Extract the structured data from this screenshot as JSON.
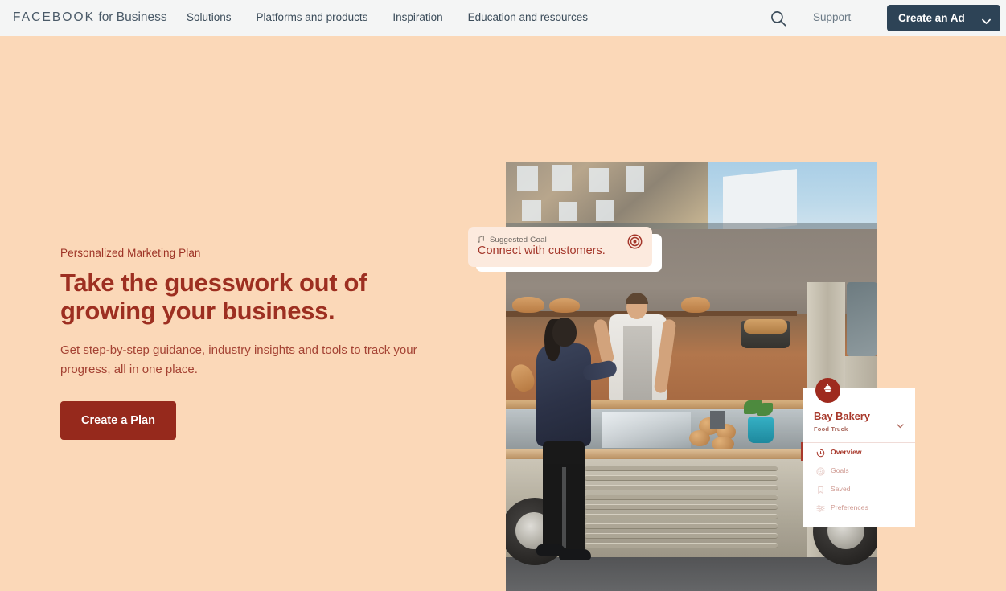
{
  "header": {
    "logo_brand": "FACEBOOK",
    "logo_suffix": " for Business",
    "nav": [
      {
        "label": "Solutions"
      },
      {
        "label": "Platforms and products"
      },
      {
        "label": "Inspiration"
      },
      {
        "label": "Education and resources"
      }
    ],
    "search_icon": "search-icon",
    "support_label": "Support",
    "cta_label": "Create an Ad",
    "cta_chevron_icon": "chevron-down-icon",
    "background": "#f4f5f5",
    "cta_color": "#2d4356"
  },
  "hero": {
    "eyebrow": "Personalized Marketing Plan",
    "headline_line1": "Take the guesswork out of",
    "headline_line2": "growing your business.",
    "subcopy_line1": "Get step-by-step guidance, industry insights and tools to",
    "subcopy_line2": "track your progress, all in one place.",
    "cta_label": "Create a Plan",
    "background": "#fbd8b8",
    "accent_color": "#9d2f21",
    "button_color": "#96291c"
  },
  "photo": {
    "alt": "Customer ordering at a vintage bakery food truck",
    "background": "#8a8077"
  },
  "goal_card": {
    "sparkle_icon": "sparkle-icon",
    "label": "Suggested Goal",
    "text": "Connect with customers.",
    "target_icon": "target-icon",
    "background": "#fceade",
    "text_color": "#a4362a"
  },
  "panel": {
    "avatar_icon": "cupcake-icon",
    "business_name": "Bay Bakery",
    "business_type": "Food Truck",
    "chevron_icon": "chevron-down-icon",
    "menu": [
      {
        "label": "Overview",
        "icon": "clock-history-icon",
        "active": true
      },
      {
        "label": "Goals",
        "icon": "target-icon",
        "active": false
      },
      {
        "label": "Saved",
        "icon": "bookmark-icon",
        "active": false
      },
      {
        "label": "Preferences",
        "icon": "sliders-icon",
        "active": false
      }
    ],
    "accent_color": "#a8392c"
  }
}
